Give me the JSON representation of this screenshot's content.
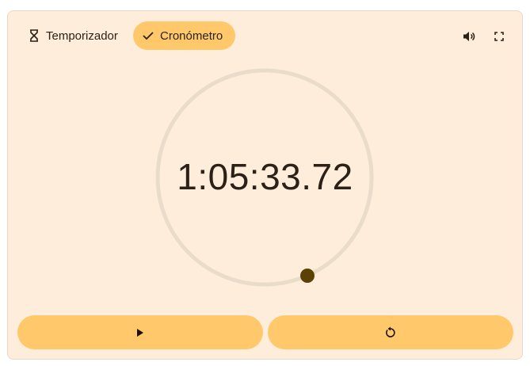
{
  "tabs": [
    {
      "label": "Temporizador",
      "icon": "hourglass-icon",
      "selected": false
    },
    {
      "label": "Cronómetro",
      "icon": "check-icon",
      "selected": true
    }
  ],
  "controls": {
    "sound_icon": "volume-icon",
    "fullscreen_icon": "fullscreen-icon",
    "play_icon": "play-icon",
    "reset_icon": "reset-icon"
  },
  "stopwatch": {
    "time": "1:05:33.72"
  },
  "colors": {
    "card_bg": "#feeddb",
    "accent": "#ffc96b",
    "dial_track": "#eadccb",
    "dial_marker": "#5c4104",
    "text": "#2b2116"
  }
}
